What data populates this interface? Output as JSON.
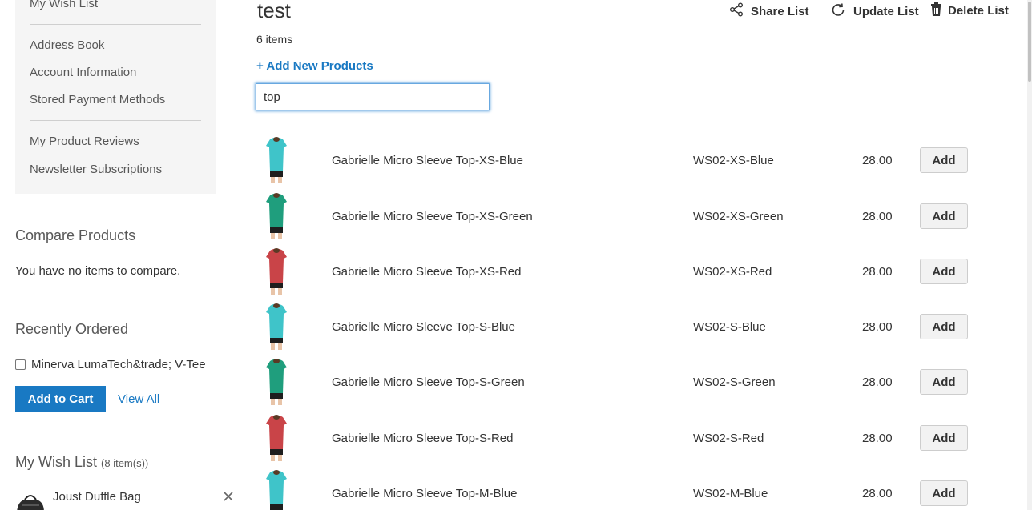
{
  "sidebar": {
    "account_nav": [
      {
        "label": "My Wish List"
      },
      {
        "label": "Address Book"
      },
      {
        "label": "Account Information"
      },
      {
        "label": "Stored Payment Methods"
      },
      {
        "label": "My Product Reviews"
      },
      {
        "label": "Newsletter Subscriptions"
      }
    ],
    "compare": {
      "title": "Compare Products",
      "empty_text": "You have no items to compare."
    },
    "recently_ordered": {
      "title": "Recently Ordered",
      "item_label": "Minerva LumaTech&trade; V-Tee",
      "add_to_cart": "Add to Cart",
      "view_all": "View All"
    },
    "wishlist": {
      "title": "My Wish List",
      "count": "(8 item(s))",
      "item_name": "Joust Duffle Bag"
    }
  },
  "main": {
    "title": "test",
    "items_count": "6 items",
    "add_new_products": "+ Add New Products",
    "actions": {
      "share": "Share List",
      "update": "Update List",
      "delete": "Delete List"
    },
    "search": {
      "value": "top"
    },
    "rows": [
      {
        "name": "Gabrielle Micro Sleeve Top-XS-Blue",
        "sku": "WS02-XS-Blue",
        "price": "28.00",
        "add": "Add",
        "color": "#3fc4c9"
      },
      {
        "name": "Gabrielle Micro Sleeve Top-XS-Green",
        "sku": "WS02-XS-Green",
        "price": "28.00",
        "add": "Add",
        "color": "#1f9e7d"
      },
      {
        "name": "Gabrielle Micro Sleeve Top-XS-Red",
        "sku": "WS02-XS-Red",
        "price": "28.00",
        "add": "Add",
        "color": "#c94448"
      },
      {
        "name": "Gabrielle Micro Sleeve Top-S-Blue",
        "sku": "WS02-S-Blue",
        "price": "28.00",
        "add": "Add",
        "color": "#3fc4c9"
      },
      {
        "name": "Gabrielle Micro Sleeve Top-S-Green",
        "sku": "WS02-S-Green",
        "price": "28.00",
        "add": "Add",
        "color": "#1f9e7d"
      },
      {
        "name": "Gabrielle Micro Sleeve Top-S-Red",
        "sku": "WS02-S-Red",
        "price": "28.00",
        "add": "Add",
        "color": "#c94448"
      },
      {
        "name": "Gabrielle Micro Sleeve Top-M-Blue",
        "sku": "WS02-M-Blue",
        "price": "28.00",
        "add": "Add",
        "color": "#3fc4c9"
      }
    ]
  },
  "colors": {
    "accent": "#1979c3",
    "sidebar_bg": "#f5f5f5",
    "focus_ring": "#68a8e0"
  },
  "icons": {
    "share": "share-icon",
    "update": "refresh-icon",
    "delete": "trash-icon",
    "close": "close-icon"
  }
}
